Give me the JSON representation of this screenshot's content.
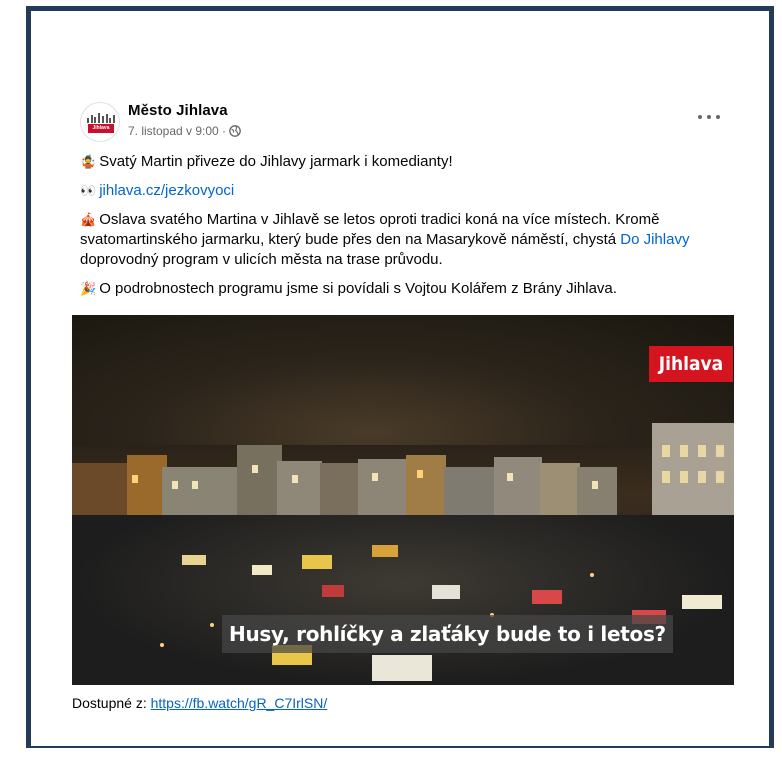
{
  "post": {
    "author": "Město Jihlava",
    "date": "7. listopad v 9:00 ·",
    "avatar_badge": "Jihlava",
    "paragraphs": {
      "p1": {
        "emoji": "🤹",
        "text": "Svatý Martin přiveze do Jihlavy jarmark i komedianty!"
      },
      "p2": {
        "emoji": "👀",
        "link": "jihlava.cz/jezkovyoci"
      },
      "p3": {
        "emoji": "🎪",
        "text_before": "Oslava svatého Martina v Jihlavě se letos oproti tradici koná na více místech. Kromě svatomartinského jarmarku, který bude přes den na Masarykově náměstí, chystá ",
        "link": "Do Jihlavy",
        "text_after": " doprovodný program v ulicích města na trase průvodu."
      },
      "p4": {
        "emoji": "🎉",
        "text": "O podrobnostech programu jsme si povídali s Vojtou Kolářem z Brány Jihlava."
      }
    },
    "video": {
      "brand": "Jihlava",
      "caption": "Husy, rohlíčky a zlaťáky bude to i letos?"
    }
  },
  "source": {
    "label": "Dostupné z:",
    "url": "https://fb.watch/gR_C7IrlSN/"
  },
  "icons": [
    "globe-icon",
    "more-options-icon"
  ],
  "colors": {
    "frame": "#233b56",
    "link": "#0064d1",
    "brand_red": "#d4151f"
  }
}
